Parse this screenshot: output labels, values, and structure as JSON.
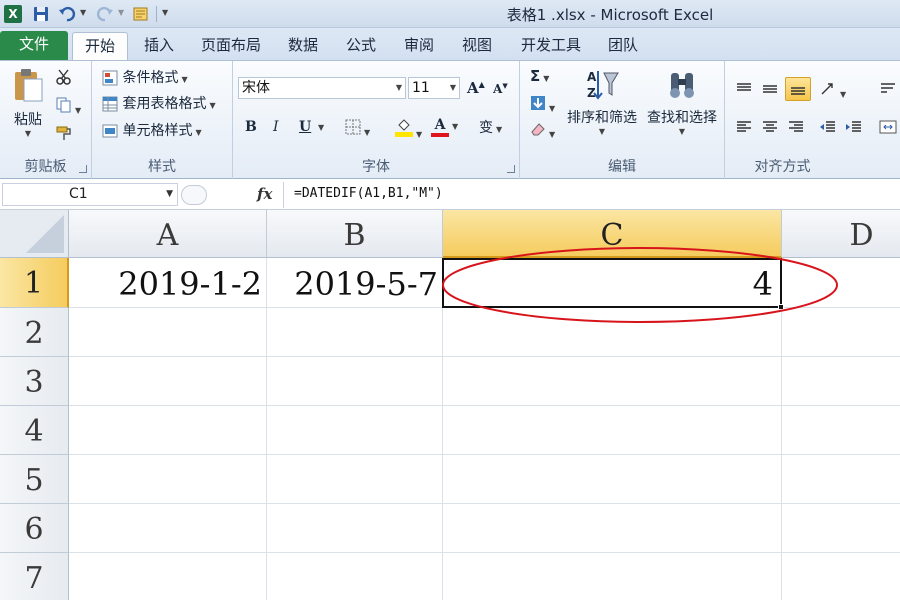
{
  "window": {
    "title": "表格1 .xlsx - Microsoft Excel"
  },
  "tabs": [
    "文件",
    "开始",
    "插入",
    "页面布局",
    "数据",
    "公式",
    "审阅",
    "视图",
    "开发工具",
    "团队"
  ],
  "ribbon": {
    "clipboard": {
      "paste": "粘贴",
      "label": "剪贴板"
    },
    "styles": {
      "conditional": "条件格式",
      "table": "套用表格格式",
      "cell": "单元格样式",
      "label": "样式"
    },
    "font": {
      "name": "宋体",
      "size": "11",
      "label": "字体",
      "bold": "B",
      "italic": "I",
      "underline": "U",
      "color_a": "A",
      "wen": "变"
    },
    "editing": {
      "sum": "Σ",
      "sort": "排序和筛选",
      "find": "查找和选择",
      "label": "编辑"
    },
    "alignment": {
      "label": "对齐方式"
    }
  },
  "formula_bar": {
    "name_box": "C1",
    "fx": "fx",
    "formula": "=DATEDIF(A1,B1,\"M\")"
  },
  "sheet": {
    "columns": [
      "A",
      "B",
      "C",
      "D"
    ],
    "rows": [
      "1",
      "2",
      "3",
      "4",
      "5",
      "6",
      "7"
    ],
    "cells": {
      "A1": "2019-1-2",
      "B1": "2019-5-7",
      "C1": "4"
    },
    "active_cell": "C1"
  },
  "colors": {
    "file_tab": "#2a8a4a",
    "active_header": "#f5cc5e",
    "annotation": "#d8141b"
  }
}
